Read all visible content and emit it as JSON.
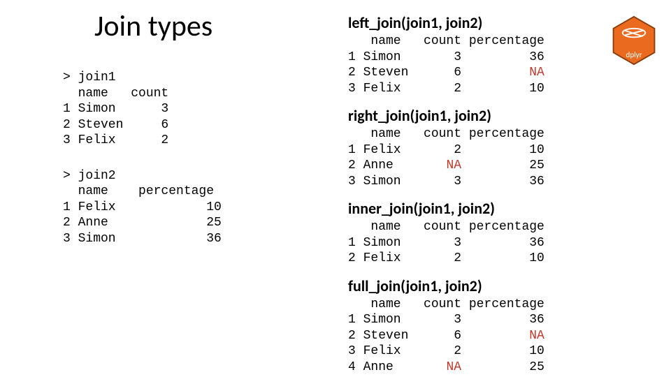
{
  "title": "Join types",
  "logo_label": "dplyr",
  "left": {
    "join1": {
      "prompt": "> join1",
      "header": "  name   count",
      "rows": [
        "1 Simon      3",
        "2 Steven     6",
        "3 Felix      2"
      ]
    },
    "join2": {
      "prompt": "> join2",
      "header": "  name    percentage",
      "rows": [
        "1 Felix            10",
        "2 Anne             25",
        "3 Simon            36"
      ]
    }
  },
  "joins": {
    "left_join": {
      "title": "left_join(join1, join2)",
      "header": "   name   count percentage",
      "rows": [
        {
          "pre": "1 Simon       3         36",
          "na": ""
        },
        {
          "pre": "2 Steven      6         ",
          "na": "NA"
        },
        {
          "pre": "3 Felix       2         10",
          "na": ""
        }
      ]
    },
    "right_join": {
      "title": "right_join(join1, join2)",
      "header": "   name   count percentage",
      "rows": [
        {
          "pre": "1 Felix       2         10",
          "na": ""
        },
        {
          "pre": "2 Anne       ",
          "na": "NA",
          "post": "         25"
        },
        {
          "pre": "3 Simon       3         36",
          "na": ""
        }
      ]
    },
    "inner_join": {
      "title": "inner_join(join1, join2)",
      "header": "   name   count percentage",
      "rows": [
        {
          "pre": "1 Simon       3         36",
          "na": ""
        },
        {
          "pre": "2 Felix       2         10",
          "na": ""
        }
      ]
    },
    "full_join": {
      "title": "full_join(join1, join2)",
      "header": "   name   count percentage",
      "rows": [
        {
          "pre": "1 Simon       3         36",
          "na": ""
        },
        {
          "pre": "2 Steven      6         ",
          "na": "NA"
        },
        {
          "pre": "3 Felix       2         10",
          "na": ""
        },
        {
          "pre": "4 Anne       ",
          "na": "NA",
          "post": "         25"
        }
      ]
    }
  }
}
